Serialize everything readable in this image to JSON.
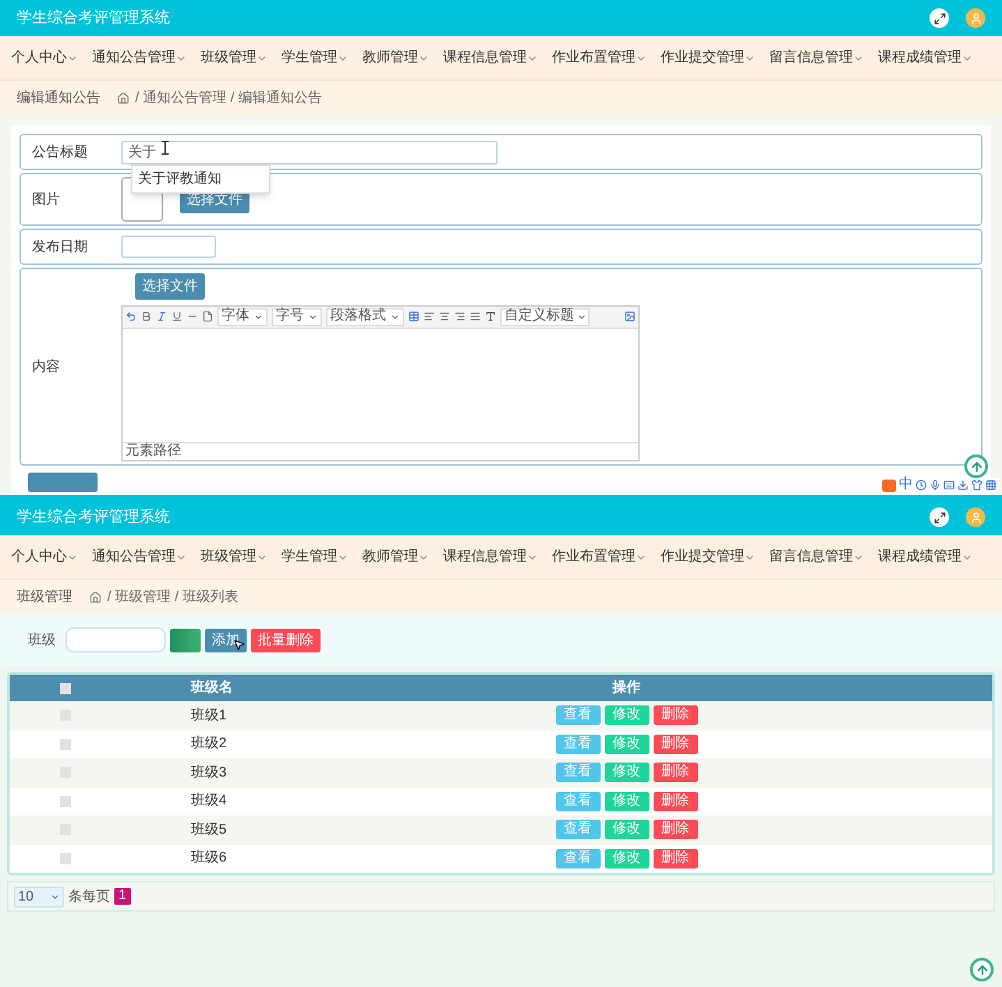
{
  "top": {
    "app_title": "学生综合考评管理系统",
    "nav": [
      "个人中心",
      "通知公告管理",
      "班级管理",
      "学生管理",
      "教师管理",
      "课程信息管理",
      "作业布置管理",
      "作业提交管理",
      "留言信息管理",
      "课程成绩管理"
    ],
    "breadcrumb": {
      "page_title": "编辑通知公告",
      "path": "/ 通知公告管理 / 编辑通知公告"
    },
    "form": {
      "fields": [
        {
          "kind": "text",
          "label": "公告标题",
          "value": "关于"
        },
        {
          "kind": "image",
          "label": "图片",
          "button": "选择文件"
        },
        {
          "kind": "date",
          "label": "发布日期"
        },
        {
          "kind": "editor",
          "label": "内容",
          "button": "选择文件",
          "toolbar_selects": [
            "字体",
            "字号",
            "段落格式",
            "自定义标题"
          ],
          "status": "元素路径"
        }
      ],
      "suggestion": "关于评教通知"
    },
    "tray": {
      "ime": "中"
    }
  },
  "bottom": {
    "app_title": "学生综合考评管理系统",
    "nav": [
      "个人中心",
      "通知公告管理",
      "班级管理",
      "学生管理",
      "教师管理",
      "课程信息管理",
      "作业布置管理",
      "作业提交管理",
      "留言信息管理",
      "课程成绩管理"
    ],
    "breadcrumb": {
      "page_title": "班级管理",
      "path": "/ 班级管理 / 班级列表"
    },
    "search": {
      "label": "班级",
      "add": "添加",
      "batch_delete": "批量删除"
    },
    "table": {
      "columns": [
        "班级名",
        "操作"
      ],
      "header_checked": false,
      "rows": [
        {
          "name": "班级1",
          "checked": false,
          "actions": [
            "查看",
            "修改",
            "删除"
          ]
        },
        {
          "name": "班级2",
          "checked": false,
          "actions": [
            "查看",
            "修改",
            "删除"
          ]
        },
        {
          "name": "班级3",
          "checked": false,
          "actions": [
            "查看",
            "修改",
            "删除"
          ]
        },
        {
          "name": "班级4",
          "checked": false,
          "actions": [
            "查看",
            "修改",
            "删除"
          ]
        },
        {
          "name": "班级5",
          "checked": false,
          "actions": [
            "查看",
            "修改",
            "删除"
          ]
        },
        {
          "name": "班级6",
          "checked": false,
          "actions": [
            "查看",
            "修改",
            "删除"
          ]
        }
      ]
    },
    "pagination": {
      "page_size": "10",
      "page_size_label": "条每页",
      "pages": [
        {
          "label": "1",
          "selected": true
        }
      ]
    }
  }
}
